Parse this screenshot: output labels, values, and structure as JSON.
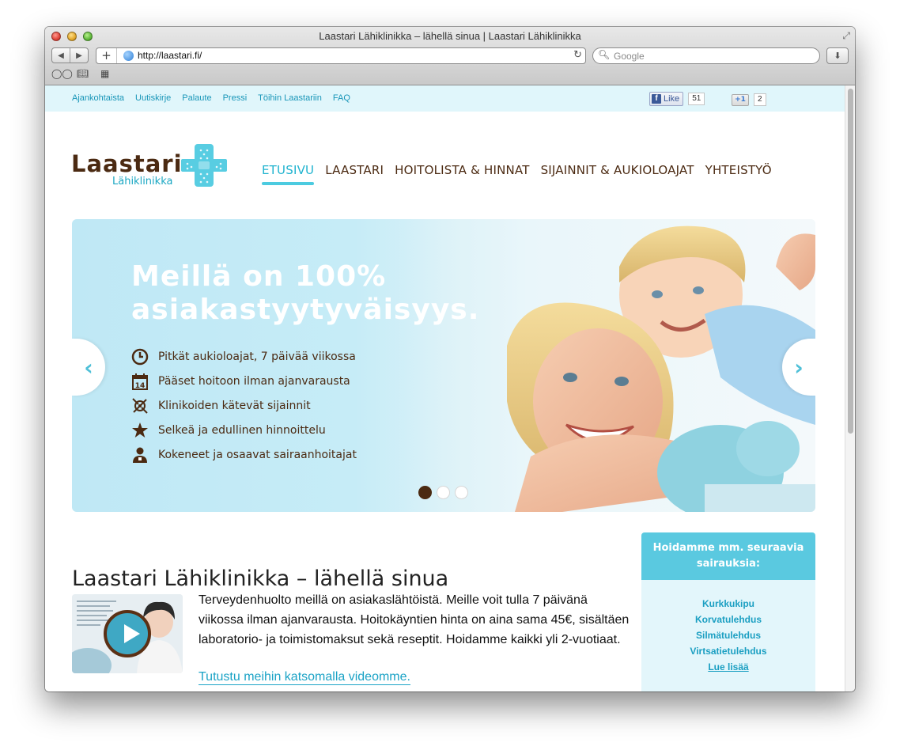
{
  "window": {
    "title": "Laastari Lähiklinikka – lähellä sinua | Laastari Lähiklinikka",
    "url": "http://laastari.fi/",
    "search_placeholder": "Google"
  },
  "topbar": {
    "links": [
      "Ajankohtaista",
      "Uutiskirje",
      "Palaute",
      "Pressi",
      "Töihin Laastariin",
      "FAQ"
    ],
    "fb_like_label": "Like",
    "fb_like_count": "51",
    "gplus_label": "+1",
    "gplus_count": "2"
  },
  "logo": {
    "word": "Laastari",
    "sub": "Lähiklinikka"
  },
  "nav": [
    "ETUSIVU",
    "LAASTARI",
    "HOITOLISTA & HINNAT",
    "SIJAINNIT & AUKIOLOAJAT",
    "YHTEISTYÖ"
  ],
  "hero": {
    "title_line1": "Meillä on 100%",
    "title_line2": "asiakastyytyväisyys.",
    "items": [
      "Pitkät aukioloajat, 7 päivää viikossa",
      "Pääset hoitoon ilman ajanvarausta",
      "Klinikoiden kätevät sijainnit",
      "Selkeä ja edullinen hinnoittelu",
      "Kokeneet ja osaavat sairaanhoitajat"
    ],
    "calendar_number": "14",
    "active_slide": 1,
    "slide_count": 3
  },
  "content": {
    "title": "Laastari Lähiklinikka – lähellä sinua",
    "body": "Terveydenhuolto meillä on asiakaslähtöistä. Meille voit tulla 7 päivänä viikossa ilman ajanvarausta. Hoitokäyntien hinta on aina sama 45€, sisältäen laboratorio- ja toimistomaksut sekä reseptit. Hoidamme kaikki yli 2-vuotiaat.",
    "video_link": "Tutustu meihin katsomalla videomme."
  },
  "sidebar": {
    "heading": "Hoidamme mm. seuraavia sairauksia:",
    "items": [
      "Kurkkukipu",
      "Korvatulehdus",
      "Silmätulehdus",
      "Virtsatietulehdus"
    ],
    "more": "Lue lisää"
  },
  "colors": {
    "brand_brown": "#4b2a12",
    "brand_cyan": "#4ccbe0",
    "link": "#1996b8"
  }
}
